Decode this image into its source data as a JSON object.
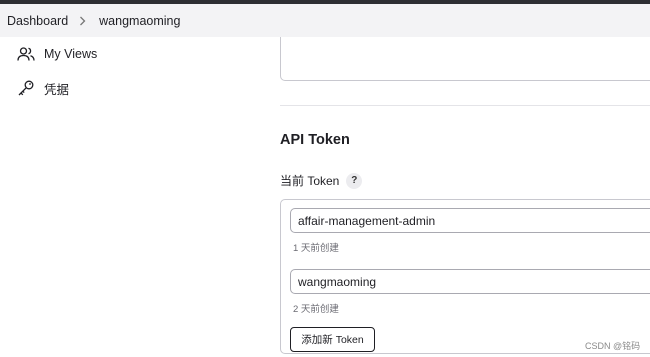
{
  "breadcrumb": {
    "items": [
      "Dashboard",
      "wangmaoming"
    ]
  },
  "sidebar": {
    "items": [
      {
        "label": "My Views",
        "icon": "people-icon"
      },
      {
        "label": "凭据",
        "icon": "key-icon"
      }
    ]
  },
  "api_token": {
    "title": "API Token",
    "current_label": "当前 Token",
    "help_label": "?",
    "tokens": [
      {
        "name": "affair-management-admin",
        "created": "1 天前创建"
      },
      {
        "name": "wangmaoming",
        "created": "2 天前创建"
      }
    ],
    "add_button": "添加新 Token"
  },
  "watermark": "CSDN @铭码",
  "colors": {
    "topbar": "#2d2e33",
    "breadcrumb_bg": "#f3f3f5",
    "text": "#1f1f24",
    "muted": "#6b6b73",
    "border": "#c8c8cf"
  }
}
